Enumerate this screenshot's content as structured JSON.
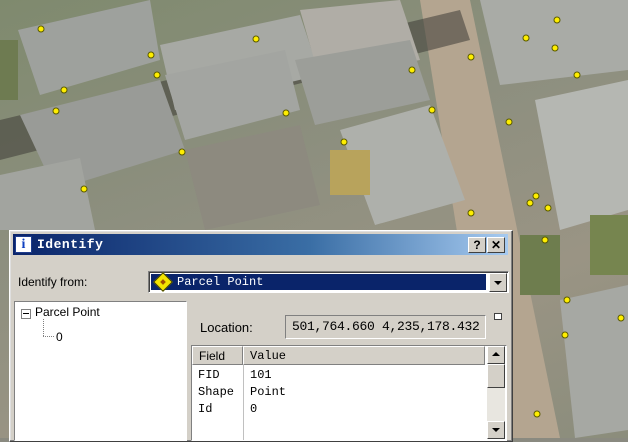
{
  "window": {
    "title": "Identify",
    "help_label": "?",
    "close_label": "✕"
  },
  "identify_from": {
    "label": "Identify from:",
    "selected": "Parcel Point"
  },
  "tree": {
    "root": "Parcel Point",
    "child": "0"
  },
  "location": {
    "label": "Location:",
    "value": "501,764.660  4,235,178.432"
  },
  "attributes": {
    "columns": [
      "Field",
      "Value"
    ],
    "rows": [
      {
        "field": "FID",
        "value": "101"
      },
      {
        "field": "Shape",
        "value": "Point"
      },
      {
        "field": "Id",
        "value": "0"
      }
    ]
  },
  "icons": {
    "title": "info-icon",
    "layer": "point-layer-icon",
    "map_point": "parcel-point-marker"
  },
  "colors": {
    "point_fill": "#ffee00",
    "title_bar": "#0a246a",
    "selection": "#0a246a"
  }
}
